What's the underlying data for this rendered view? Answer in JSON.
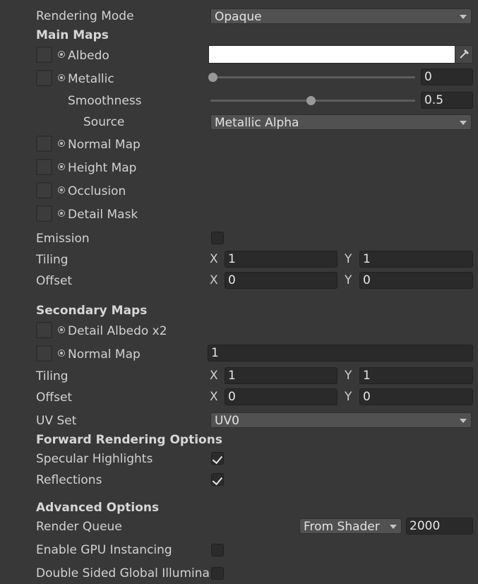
{
  "rendering_mode": {
    "label": "Rendering Mode",
    "value": "Opaque"
  },
  "main_maps": {
    "title": "Main Maps",
    "albedo_label": "Albedo",
    "metallic_label": "Metallic",
    "metallic_value": "0",
    "metallic_fraction": 0,
    "smoothness_label": "Smoothness",
    "smoothness_value": "0.5",
    "smoothness_fraction": 0.5,
    "source_label": "Source",
    "source_value": "Metallic Alpha",
    "normal_map_label": "Normal Map",
    "height_map_label": "Height Map",
    "occlusion_label": "Occlusion",
    "detail_mask_label": "Detail Mask",
    "emission_label": "Emission",
    "tiling_label": "Tiling",
    "tiling_x": "1",
    "tiling_y": "1",
    "offset_label": "Offset",
    "offset_x": "0",
    "offset_y": "0"
  },
  "secondary_maps": {
    "title": "Secondary Maps",
    "detail_albedo_label": "Detail Albedo x2",
    "normal_map_label": "Normal Map",
    "normal_scale": "1",
    "tiling_label": "Tiling",
    "tiling_x": "1",
    "tiling_y": "1",
    "offset_label": "Offset",
    "offset_x": "0",
    "offset_y": "0",
    "uv_set_label": "UV Set",
    "uv_set_value": "UV0"
  },
  "forward_options": {
    "title": "Forward Rendering Options",
    "specular_label": "Specular Highlights",
    "specular_checked": true,
    "reflections_label": "Reflections",
    "reflections_checked": true
  },
  "advanced_options": {
    "title": "Advanced Options",
    "render_queue_label": "Render Queue",
    "render_queue_mode": "From Shader",
    "render_queue_value": "2000",
    "gpu_instancing_label": "Enable GPU Instancing",
    "double_sided_label": "Double Sided Global Illumina"
  },
  "axis_labels": {
    "x": "X",
    "y": "Y"
  },
  "colors": {
    "background": "#383838",
    "albedo": "#ffffff"
  }
}
